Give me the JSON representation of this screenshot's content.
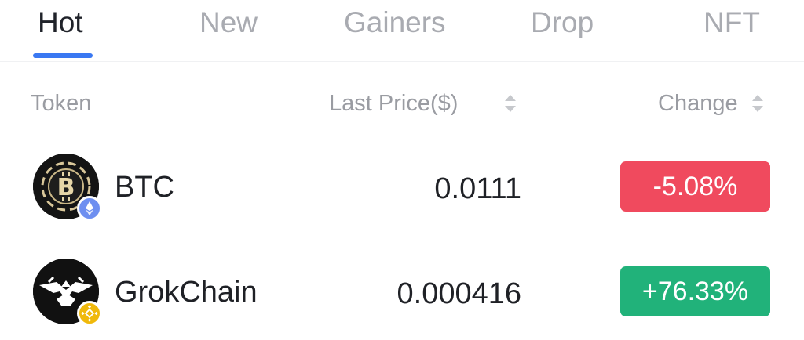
{
  "tabs": [
    {
      "label": "Hot",
      "active": true
    },
    {
      "label": "New",
      "active": false
    },
    {
      "label": "Gainers",
      "active": false
    },
    {
      "label": "Drop",
      "active": false
    },
    {
      "label": "NFT",
      "active": false
    }
  ],
  "table": {
    "headers": {
      "token": "Token",
      "last_price": "Last Price($)",
      "change": "Change"
    },
    "rows": [
      {
        "token": "BTC",
        "logo_icon": "bitcoin-coin-icon",
        "chain_icon": "ethereum-chain-icon",
        "price": "0.0111",
        "change": "-5.08%",
        "change_color": "#f04a5e"
      },
      {
        "token": "GrokChain",
        "logo_icon": "grokchain-logo-icon",
        "chain_icon": "bnb-chain-icon",
        "price": "0.000416",
        "change": "+76.33%",
        "change_color": "#21b27a"
      }
    ]
  },
  "colors": {
    "accent": "#3a78f2",
    "negative": "#f04a5e",
    "positive": "#21b27a"
  }
}
